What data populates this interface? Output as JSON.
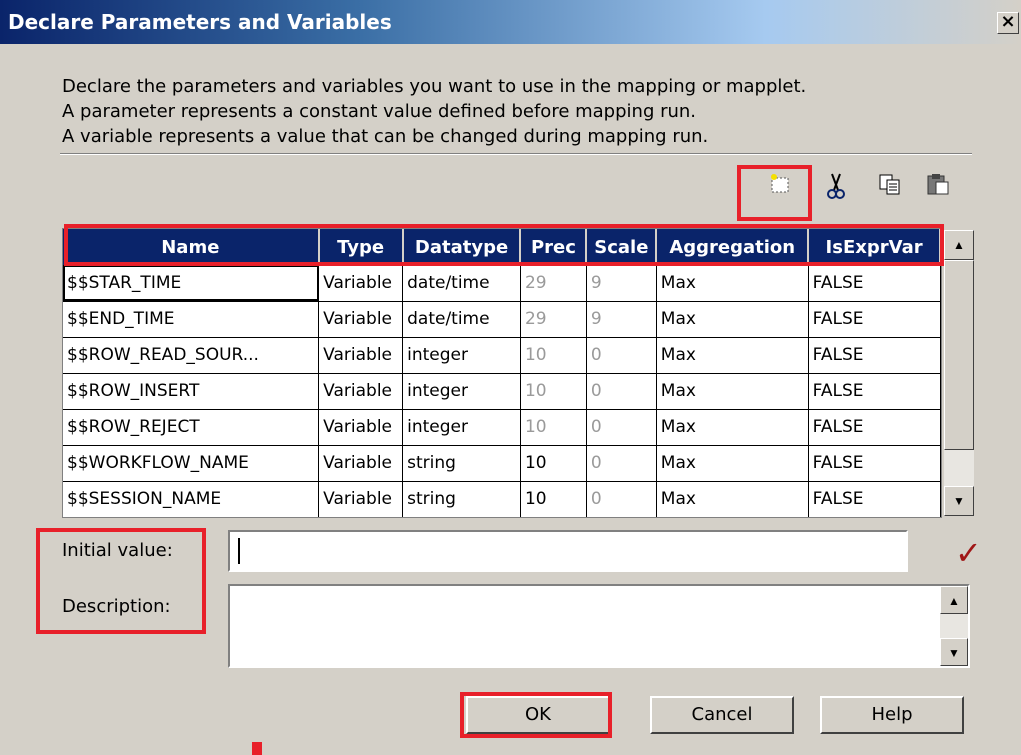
{
  "window": {
    "title": "Declare Parameters and Variables",
    "close": "×"
  },
  "description": [
    "Declare the parameters and variables you want to use in the mapping or mapplet.",
    "A parameter represents a constant value defined before mapping run.",
    "A variable represents a value that can be changed during mapping run."
  ],
  "toolbar": {
    "new_icon": "new-item-icon",
    "cut_icon": "cut-icon",
    "copy_icon": "copy-icon",
    "paste_icon": "paste-icon"
  },
  "columns": [
    "Name",
    "Type",
    "Datatype",
    "Prec",
    "Scale",
    "Aggregation",
    "IsExprVar"
  ],
  "rows": [
    [
      "$$STAR_TIME",
      "Variable",
      "date/time",
      "29",
      "9",
      "Max",
      "FALSE"
    ],
    [
      "$$END_TIME",
      "Variable",
      "date/time",
      "29",
      "9",
      "Max",
      "FALSE"
    ],
    [
      "$$ROW_READ_SOUR...",
      "Variable",
      "integer",
      "10",
      "0",
      "Max",
      "FALSE"
    ],
    [
      "$$ROW_INSERT",
      "Variable",
      "integer",
      "10",
      "0",
      "Max",
      "FALSE"
    ],
    [
      "$$ROW_REJECT",
      "Variable",
      "integer",
      "10",
      "0",
      "Max",
      "FALSE"
    ],
    [
      "$$WORKFLOW_NAME",
      "Variable",
      "string",
      "10",
      "0",
      "Max",
      "FALSE"
    ],
    [
      "$$SESSION_NAME",
      "Variable",
      "string",
      "10",
      "0",
      "Max",
      "FALSE"
    ]
  ],
  "form": {
    "initial_value_label": "Initial value:",
    "initial_value": "",
    "description_label": "Description:",
    "description_value": ""
  },
  "buttons": {
    "ok": "OK",
    "cancel": "Cancel",
    "help": "Help"
  },
  "colors": {
    "highlight": "#e8202a",
    "header_bg": "#0a246a",
    "dialog_bg": "#d4d0c8"
  }
}
